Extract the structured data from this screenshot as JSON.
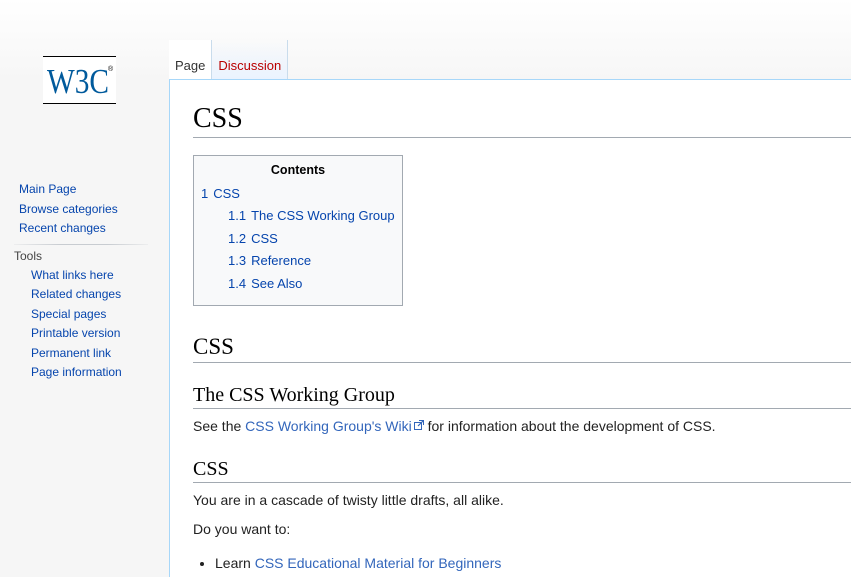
{
  "logo": {
    "text": "W3C"
  },
  "tabs": [
    {
      "label": "Page",
      "selected": true
    },
    {
      "label": "Discussion",
      "selected": false
    }
  ],
  "sidebar": {
    "navigation": [
      {
        "label": "Main Page"
      },
      {
        "label": "Browse categories"
      },
      {
        "label": "Recent changes"
      }
    ],
    "tools_heading": "Tools",
    "tools": [
      {
        "label": "What links here"
      },
      {
        "label": "Related changes"
      },
      {
        "label": "Special pages"
      },
      {
        "label": "Printable version"
      },
      {
        "label": "Permanent link"
      },
      {
        "label": "Page information"
      }
    ]
  },
  "page": {
    "title": "CSS",
    "toc": {
      "title": "Contents",
      "items": [
        {
          "num": "1",
          "label": "CSS"
        },
        {
          "num": "1.1",
          "label": "The CSS Working Group"
        },
        {
          "num": "1.2",
          "label": "CSS"
        },
        {
          "num": "1.3",
          "label": "Reference"
        },
        {
          "num": "1.4",
          "label": "See Also"
        }
      ]
    },
    "section1_heading": "CSS",
    "wg_heading": "The CSS Working Group",
    "wg_para_before": "See the ",
    "wg_link": "CSS Working Group's Wiki",
    "wg_para_after": " for information about the development of CSS.",
    "css_heading": "CSS",
    "css_para1": "You are in a cascade of twisty little drafts, all alike.",
    "css_para2": "Do you want to:",
    "list_item_prefix": "Learn ",
    "list_item_link": "CSS Educational Material for Beginners"
  },
  "colors": {
    "link": "#0645ad",
    "new_link": "#ba0000",
    "external_link": "#3366bb",
    "border": "#a7d7f9"
  }
}
